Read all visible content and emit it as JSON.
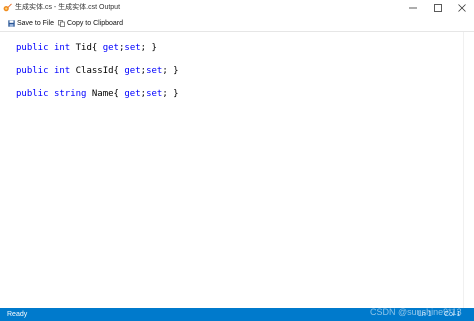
{
  "window": {
    "title": "生成实体.cs - 生成实体.cst Output",
    "accent_color": "#007acc",
    "app_icon": "codesmith-flame-icon"
  },
  "toolbar": {
    "save_label": "Save to File",
    "copy_label": "Copy to Clipboard"
  },
  "code": {
    "lines": [
      {
        "tokens": [
          {
            "text": "public",
            "kw": true
          },
          {
            "text": " ",
            "kw": false
          },
          {
            "text": "int",
            "kw": true
          },
          {
            "text": " Tid{ ",
            "kw": false
          },
          {
            "text": "get",
            "kw": true
          },
          {
            "text": ";",
            "kw": false
          },
          {
            "text": "set",
            "kw": true
          },
          {
            "text": "; }",
            "kw": false
          }
        ]
      },
      {
        "tokens": [
          {
            "text": "public",
            "kw": true
          },
          {
            "text": " ",
            "kw": false
          },
          {
            "text": "int",
            "kw": true
          },
          {
            "text": " ClassId{ ",
            "kw": false
          },
          {
            "text": "get",
            "kw": true
          },
          {
            "text": ";",
            "kw": false
          },
          {
            "text": "set",
            "kw": true
          },
          {
            "text": "; }",
            "kw": false
          }
        ]
      },
      {
        "tokens": [
          {
            "text": "public",
            "kw": true
          },
          {
            "text": " ",
            "kw": false
          },
          {
            "text": "string",
            "kw": true
          },
          {
            "text": " Name{ ",
            "kw": false
          },
          {
            "text": "get",
            "kw": true
          },
          {
            "text": ";",
            "kw": false
          },
          {
            "text": "set",
            "kw": true
          },
          {
            "text": "; }",
            "kw": false
          }
        ]
      }
    ]
  },
  "status": {
    "text": "Ready",
    "ln": "Ln 1",
    "col": "Col 1"
  },
  "watermark": "CSDN @sunshine9*13"
}
